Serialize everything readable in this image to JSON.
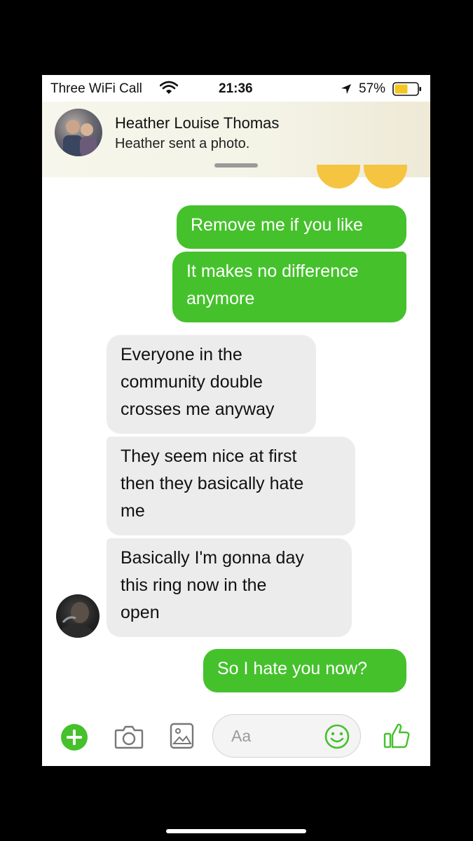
{
  "status_bar": {
    "carrier": "Three WiFi Call",
    "time": "21:36",
    "battery": "57%"
  },
  "notification": {
    "title": "Heather Louise Thomas",
    "body": "Heather sent a photo."
  },
  "messages": [
    {
      "direction": "outgoing",
      "text": "Remove me if you like"
    },
    {
      "direction": "outgoing",
      "lines": [
        "It makes no difference",
        "anymore"
      ]
    },
    {
      "direction": "incoming",
      "lines": [
        "Everyone in the",
        "community double",
        "crosses me anyway"
      ]
    },
    {
      "direction": "incoming",
      "lines": [
        "They seem nice at first",
        "then they basically hate",
        "me"
      ]
    },
    {
      "direction": "incoming",
      "lines": [
        "Basically I'm gonna day",
        "this ring now in the",
        "open"
      ]
    },
    {
      "direction": "outgoing",
      "text": "So I hate you now?"
    }
  ],
  "composer": {
    "placeholder": "Aa",
    "icons": [
      "plus-icon",
      "camera-icon",
      "gallery-icon",
      "smiley-icon",
      "thumbs-up-icon"
    ]
  },
  "colors": {
    "accent": "#45c12c",
    "incoming_bubble": "#ececec",
    "battery_fill": "#f3c623"
  }
}
